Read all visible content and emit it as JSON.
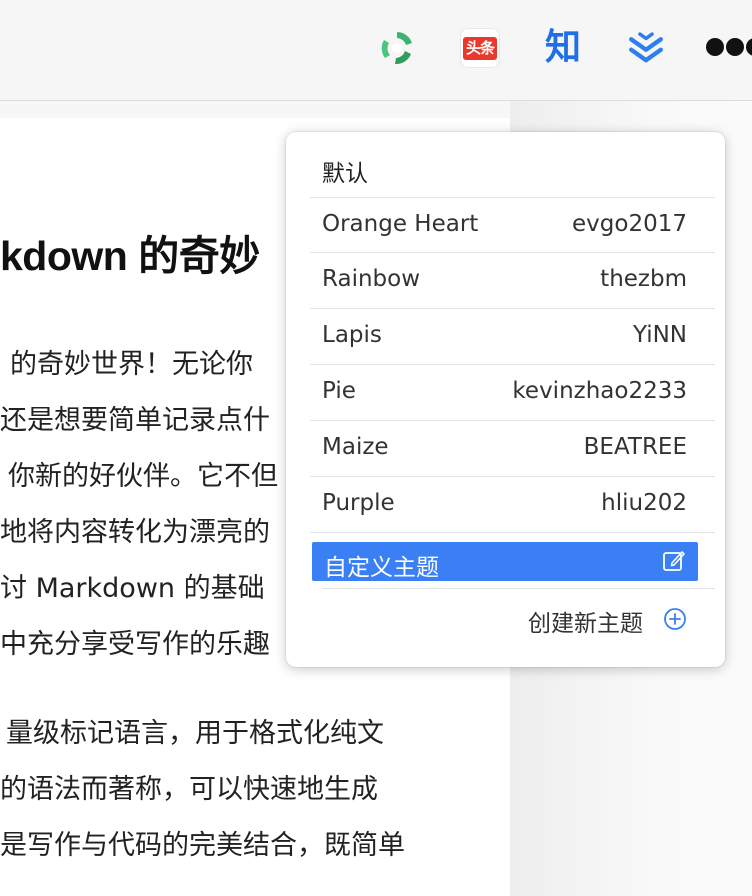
{
  "toolbar": {
    "extensions": [
      {
        "name": "green-circular-arrows-icon"
      },
      {
        "name": "toutiao-icon",
        "text": "头条"
      },
      {
        "name": "zhihu-icon",
        "text": "知"
      },
      {
        "name": "blue-chevrons-icon"
      }
    ]
  },
  "editor": {
    "heading": "kdown 的奇妙",
    "lines": [
      "的奇妙世界！无论你",
      "还是想要简单记录点什",
      "你新的好伙伴。它不但",
      "地将内容转化为漂亮的",
      "讨 Markdown 的基础",
      "中充分享受写作的乐趣",
      "量级标记语言，用于格式化纯文",
      "的语法而著称，可以快速地生成",
      "是写作与代码的完美结合，既简单"
    ]
  },
  "theme_menu": {
    "default_label": "默认",
    "themes": [
      {
        "name": "Orange Heart",
        "author": "evgo2017"
      },
      {
        "name": "Rainbow",
        "author": "thezbm"
      },
      {
        "name": "Lapis",
        "author": "YiNN"
      },
      {
        "name": "Pie",
        "author": "kevinzhao2233"
      },
      {
        "name": "Maize",
        "author": "BEATREE"
      },
      {
        "name": "Purple",
        "author": "hliu202"
      }
    ],
    "custom_label": "自定义主题",
    "create_label": "创建新主题",
    "accent_color": "#3a7ff3"
  }
}
